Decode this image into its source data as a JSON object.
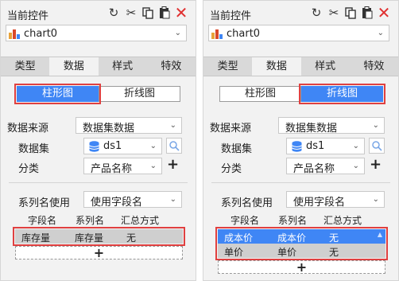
{
  "left": {
    "toolbar": {
      "title": "当前控件"
    },
    "chart_select": {
      "value": "chart0"
    },
    "tabs": [
      "类型",
      "数据",
      "样式",
      "特效"
    ],
    "active_tab": 1,
    "chart_type": {
      "bar": "柱形图",
      "line": "折线图",
      "selected": "bar"
    },
    "data_source": {
      "label": "数据来源",
      "value": "数据集数据"
    },
    "dataset": {
      "label": "数据集",
      "value": "ds1"
    },
    "category": {
      "label": "分类",
      "value": "产品名称"
    },
    "series": {
      "label": "系列名使用",
      "value": "使用字段名"
    },
    "columns": [
      "字段名",
      "系列名",
      "汇总方式"
    ],
    "rows": [
      {
        "field": "库存量",
        "name": "库存量",
        "agg": "无",
        "selected": false
      }
    ]
  },
  "right": {
    "toolbar": {
      "title": "当前控件"
    },
    "chart_select": {
      "value": "chart0"
    },
    "tabs": [
      "类型",
      "数据",
      "样式",
      "特效"
    ],
    "active_tab": 1,
    "chart_type": {
      "bar": "柱形图",
      "line": "折线图",
      "selected": "line"
    },
    "data_source": {
      "label": "数据来源",
      "value": "数据集数据"
    },
    "dataset": {
      "label": "数据集",
      "value": "ds1"
    },
    "category": {
      "label": "分类",
      "value": "产品名称"
    },
    "series": {
      "label": "系列名使用",
      "value": "使用字段名"
    },
    "columns": [
      "字段名",
      "系列名",
      "汇总方式"
    ],
    "rows": [
      {
        "field": "成本价",
        "name": "成本价",
        "agg": "无",
        "selected": true
      },
      {
        "field": "单价",
        "name": "单价",
        "agg": "无",
        "selected": false
      }
    ]
  },
  "icons": {
    "toolbar": [
      "refresh-icon",
      "cut-icon",
      "copy-icon",
      "paste-icon",
      "close-icon"
    ],
    "close_color": "#e03030",
    "accent": "#3f86f5",
    "highlight": "#e04040"
  }
}
